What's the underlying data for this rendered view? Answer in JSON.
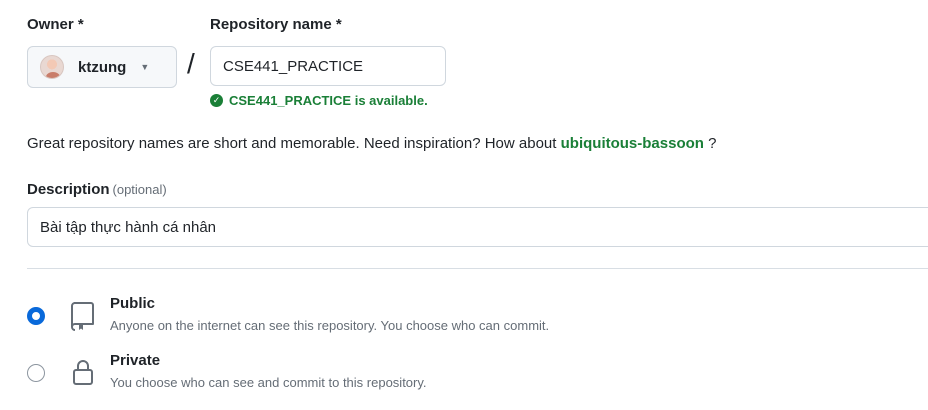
{
  "owner": {
    "label": "Owner *",
    "value": "ktzung"
  },
  "repository": {
    "label": "Repository name *",
    "value": "CSE441_PRACTICE",
    "availability": "CSE441_PRACTICE is available."
  },
  "hint": {
    "text": "Great repository names are short and memorable. Need inspiration? How about",
    "suggestion": "ubiquitous-bassoon",
    "suffix": "?"
  },
  "description": {
    "label": "Description",
    "optional": "(optional)",
    "value": "Bài tập thực hành cá nhân"
  },
  "visibility": {
    "selected": "public",
    "options": [
      {
        "id": "public",
        "title": "Public",
        "description": "Anyone on the internet can see this repository. You choose who can commit.",
        "icon": "repo-icon"
      },
      {
        "id": "private",
        "title": "Private",
        "description": "You choose who can see and commit to this repository.",
        "icon": "lock-icon"
      }
    ]
  },
  "colors": {
    "accent": "#0969da",
    "success": "#1a7f37",
    "border": "#d0d7de"
  }
}
